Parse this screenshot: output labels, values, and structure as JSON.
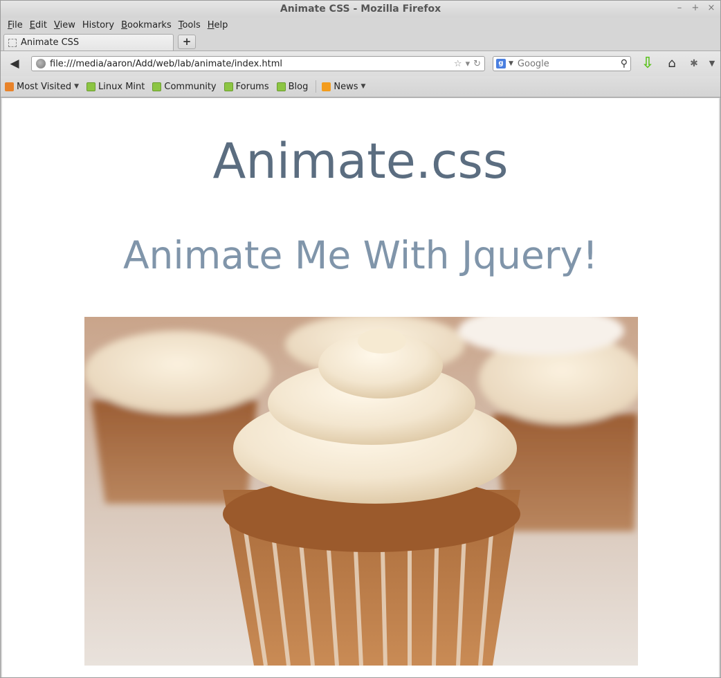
{
  "window": {
    "title": "Animate CSS - Mozilla Firefox",
    "controls": [
      "–",
      "+",
      "×"
    ]
  },
  "menu": [
    {
      "label": "File",
      "accel": "F",
      "rest": "ile"
    },
    {
      "label": "Edit",
      "accel": "E",
      "rest": "dit"
    },
    {
      "label": "View",
      "accel": "V",
      "rest": "iew"
    },
    {
      "label": "History",
      "accel": "",
      "rest": "History"
    },
    {
      "label": "Bookmarks",
      "accel": "B",
      "rest": "ookmarks"
    },
    {
      "label": "Tools",
      "accel": "T",
      "rest": "ools"
    },
    {
      "label": "Help",
      "accel": "H",
      "rest": "elp"
    }
  ],
  "tab": {
    "label": "Animate CSS"
  },
  "navbar": {
    "url": "file:///media/aaron/Add/web/lab/animate/index.html",
    "search_placeholder": "Google",
    "search_engine_icon": "g"
  },
  "bookmarks": [
    {
      "label": "Most Visited",
      "icon": "most-visited-icon",
      "dropdown": true
    },
    {
      "label": "Linux Mint",
      "icon": "linux-mint-icon",
      "dropdown": false
    },
    {
      "label": "Community",
      "icon": "linux-mint-icon",
      "dropdown": false
    },
    {
      "label": "Forums",
      "icon": "linux-mint-icon",
      "dropdown": false
    },
    {
      "label": "Blog",
      "icon": "linux-mint-icon",
      "dropdown": false
    },
    {
      "label": "News",
      "icon": "rss-icon",
      "dropdown": true
    }
  ],
  "page": {
    "heading": "Animate.css",
    "subheading": "Animate Me With Jquery!",
    "image_subject": "cupcakes with frosting"
  }
}
